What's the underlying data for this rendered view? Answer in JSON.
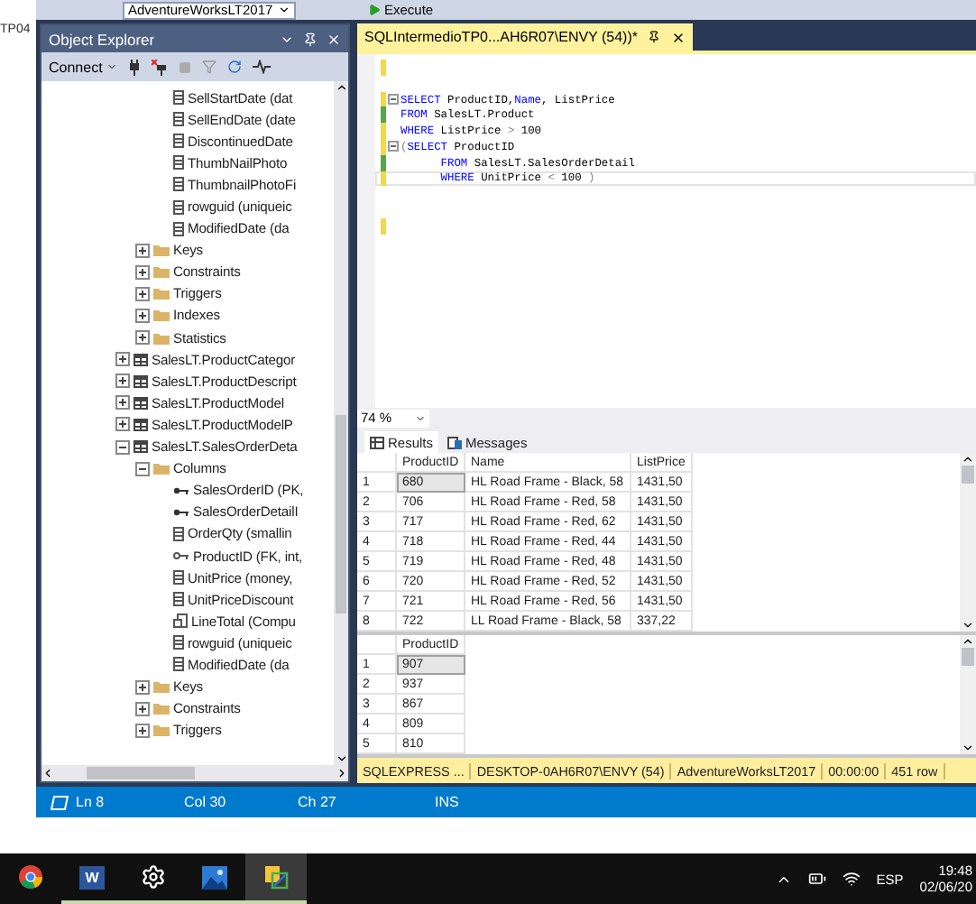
{
  "left_window": {
    "text": "TP04"
  },
  "toolbar": {
    "database": "AdventureWorksLT2017",
    "execute": "Execute"
  },
  "object_explorer": {
    "title": "Object Explorer",
    "connect": "Connect",
    "tree": [
      {
        "kind": "group",
        "children": [
          {
            "kind": "group",
            "children": [
              {
                "kind": "column",
                "label": "SellStartDate (dat"
              },
              {
                "kind": "column",
                "label": "SellEndDate (date"
              },
              {
                "kind": "column",
                "label": "DiscontinuedDate"
              },
              {
                "kind": "column",
                "label": "ThumbNailPhoto"
              },
              {
                "kind": "column",
                "label": "ThumbnailPhotoFi"
              },
              {
                "kind": "column",
                "label": "rowguid (uniqueic"
              },
              {
                "kind": "column",
                "label": "ModifiedDate (da"
              }
            ]
          },
          {
            "kind": "folder",
            "label": "Keys",
            "expanded": false
          },
          {
            "kind": "folder",
            "label": "Constraints",
            "expanded": false
          },
          {
            "kind": "folder",
            "label": "Triggers",
            "expanded": false
          },
          {
            "kind": "folder",
            "label": "Indexes",
            "expanded": false
          },
          {
            "kind": "folder",
            "label": "Statistics",
            "expanded": false
          }
        ]
      },
      {
        "kind": "table",
        "label": "SalesLT.ProductCategor",
        "expanded": false
      },
      {
        "kind": "table",
        "label": "SalesLT.ProductDescript",
        "expanded": false
      },
      {
        "kind": "table",
        "label": "SalesLT.ProductModel",
        "expanded": false
      },
      {
        "kind": "table",
        "label": "SalesLT.ProductModelP",
        "expanded": false
      },
      {
        "kind": "table",
        "label": "SalesLT.SalesOrderDeta",
        "expanded": true,
        "children": [
          {
            "kind": "folder",
            "label": "Columns",
            "expanded": true,
            "children": [
              {
                "kind": "key",
                "label": "SalesOrderID (PK,"
              },
              {
                "kind": "key",
                "label": "SalesOrderDetailI"
              },
              {
                "kind": "column",
                "label": "OrderQty (smallin"
              },
              {
                "kind": "foreign-key",
                "label": "ProductID (FK, int,"
              },
              {
                "kind": "column",
                "label": "UnitPrice (money,"
              },
              {
                "kind": "column",
                "label": "UnitPriceDiscount"
              },
              {
                "kind": "computed",
                "label": "LineTotal (Compu"
              },
              {
                "kind": "column",
                "label": "rowguid (uniqueic"
              },
              {
                "kind": "column",
                "label": "ModifiedDate (da"
              }
            ]
          },
          {
            "kind": "folder",
            "label": "Keys",
            "expanded": false
          },
          {
            "kind": "folder",
            "label": "Constraints",
            "expanded": false
          },
          {
            "kind": "folder",
            "label": "Triggers",
            "expanded": false
          }
        ]
      }
    ]
  },
  "editor": {
    "tab": "SQLIntermedioTP0...AH6R07\\ENVY (54))*",
    "lines": [
      {
        "modified": true,
        "saved": false,
        "current": false
      },
      {
        "modified": false,
        "current": false
      },
      {
        "modified": true,
        "saved": false,
        "fold": true,
        "current": false,
        "tokens": [
          {
            "kind": "keyword",
            "text": "SELECT"
          },
          {
            "kind": "plain",
            "text": " ProductID,"
          },
          {
            "kind": "keyword",
            "text": "Name"
          },
          {
            "kind": "plain",
            "text": ", ListPrice"
          }
        ]
      },
      {
        "modified": true,
        "saved": true,
        "fold": false,
        "current": false,
        "tokens": [
          {
            "kind": "keyword",
            "text": "FROM"
          },
          {
            "kind": "plain",
            "text": " SalesLT.Product"
          }
        ]
      },
      {
        "modified": true,
        "saved": false,
        "fold": false,
        "current": false,
        "tokens": [
          {
            "kind": "keyword",
            "text": "WHERE"
          },
          {
            "kind": "plain",
            "text": " ListPrice "
          },
          {
            "kind": "operator",
            "text": ">"
          },
          {
            "kind": "plain",
            "text": " 100"
          }
        ]
      },
      {
        "modified": true,
        "saved": false,
        "fold": true,
        "current": false,
        "tokens": [
          {
            "kind": "operator",
            "text": "("
          },
          {
            "kind": "keyword",
            "text": "SELECT"
          },
          {
            "kind": "plain",
            "text": " ProductID"
          }
        ]
      },
      {
        "modified": true,
        "saved": true,
        "fold": false,
        "current": false,
        "tokens": [
          {
            "kind": "keyword",
            "text": "      FROM"
          },
          {
            "kind": "plain",
            "text": " SalesLT.SalesOrderDetail"
          }
        ]
      },
      {
        "modified": true,
        "saved": false,
        "fold": false,
        "current": true,
        "tokens": [
          {
            "kind": "keyword",
            "text": "      WHERE"
          },
          {
            "kind": "plain",
            "text": " UnitPrice "
          },
          {
            "kind": "operator",
            "text": "<"
          },
          {
            "kind": "plain",
            "text": " 100 "
          },
          {
            "kind": "operator",
            "text": ")"
          }
        ]
      },
      {
        "modified": false,
        "current": false
      },
      {
        "modified": false,
        "current": false
      },
      {
        "modified": true,
        "saved": false,
        "current": false
      }
    ]
  },
  "zoom": "74 %",
  "result_tabs": [
    {
      "label": "Results",
      "kind": "grid",
      "selected": true
    },
    {
      "label": "Messages",
      "kind": "messages",
      "selected": false
    }
  ],
  "grids": [
    {
      "columns": [
        "ProductID",
        "Name",
        "ListPrice"
      ],
      "rows": [
        {
          "number": "1",
          "cells": [
            "680",
            "HL Road Frame - Black, 58",
            "1431,50"
          ],
          "selected": true
        },
        {
          "number": "2",
          "cells": [
            "706",
            "HL Road Frame - Red, 58",
            "1431,50"
          ],
          "selected": false
        },
        {
          "number": "3",
          "cells": [
            "717",
            "HL Road Frame - Red, 62",
            "1431,50"
          ],
          "selected": false
        },
        {
          "number": "4",
          "cells": [
            "718",
            "HL Road Frame - Red, 44",
            "1431,50"
          ],
          "selected": false
        },
        {
          "number": "5",
          "cells": [
            "719",
            "HL Road Frame - Red, 48",
            "1431,50"
          ],
          "selected": false
        },
        {
          "number": "6",
          "cells": [
            "720",
            "HL Road Frame - Red, 52",
            "1431,50"
          ],
          "selected": false
        },
        {
          "number": "7",
          "cells": [
            "721",
            "HL Road Frame - Red, 56",
            "1431,50"
          ],
          "selected": false
        },
        {
          "number": "8",
          "cells": [
            "722",
            "LL Road Frame - Black, 58",
            "337,22"
          ],
          "selected": false
        }
      ]
    },
    {
      "columns": [
        "ProductID"
      ],
      "rows": [
        {
          "number": "1",
          "cells": [
            "907"
          ],
          "selected": true
        },
        {
          "number": "2",
          "cells": [
            "937"
          ],
          "selected": false
        },
        {
          "number": "3",
          "cells": [
            "867"
          ],
          "selected": false
        },
        {
          "number": "4",
          "cells": [
            "809"
          ],
          "selected": false
        },
        {
          "number": "5",
          "cells": [
            "810"
          ],
          "selected": false
        }
      ]
    }
  ],
  "query_status": [
    "SQLEXPRESS ...",
    "DESKTOP-0AH6R07\\ENVY (54)",
    "AdventureWorksLT2017",
    "00:00:00",
    "451 row"
  ],
  "status_bar": {
    "ln": "Ln 8",
    "col": "Col 30",
    "ch": "Ch 27",
    "mode": "INS"
  },
  "taskbar": {
    "apps": [
      {
        "kind": "browser",
        "running": false,
        "selected": false
      },
      {
        "kind": "word",
        "label": "W",
        "running": true,
        "selected": false
      },
      {
        "kind": "settings",
        "running": true,
        "selected": false
      },
      {
        "kind": "photos",
        "running": true,
        "selected": false
      },
      {
        "kind": "snip",
        "running": true,
        "selected": true
      }
    ],
    "language": "ESP",
    "time": "19:48",
    "date": "02/06/20"
  }
}
